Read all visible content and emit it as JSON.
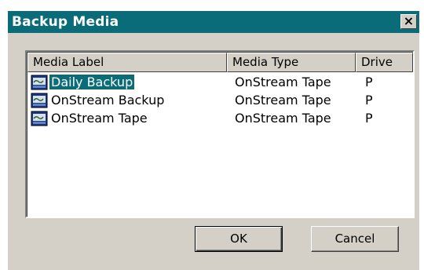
{
  "window": {
    "title": "Backup Media",
    "close_glyph": "×"
  },
  "list": {
    "columns": [
      "Media Label",
      "Media Type",
      "Drive"
    ],
    "rows": [
      {
        "label": "Daily Backup",
        "type": "OnStream Tape",
        "drive": "P",
        "icon": "tape-media-icon",
        "selected": true
      },
      {
        "label": "OnStream Backup",
        "type": "OnStream Tape",
        "drive": "P",
        "icon": "tape-media-icon",
        "selected": false
      },
      {
        "label": "OnStream Tape",
        "type": "OnStream Tape",
        "drive": "P",
        "icon": "tape-media-icon",
        "selected": false
      }
    ]
  },
  "buttons": {
    "ok": "OK",
    "cancel": "Cancel"
  },
  "colors": {
    "titlebar": "#0a6c78",
    "face": "#d4d0c8",
    "selection": "#0a6c78"
  }
}
